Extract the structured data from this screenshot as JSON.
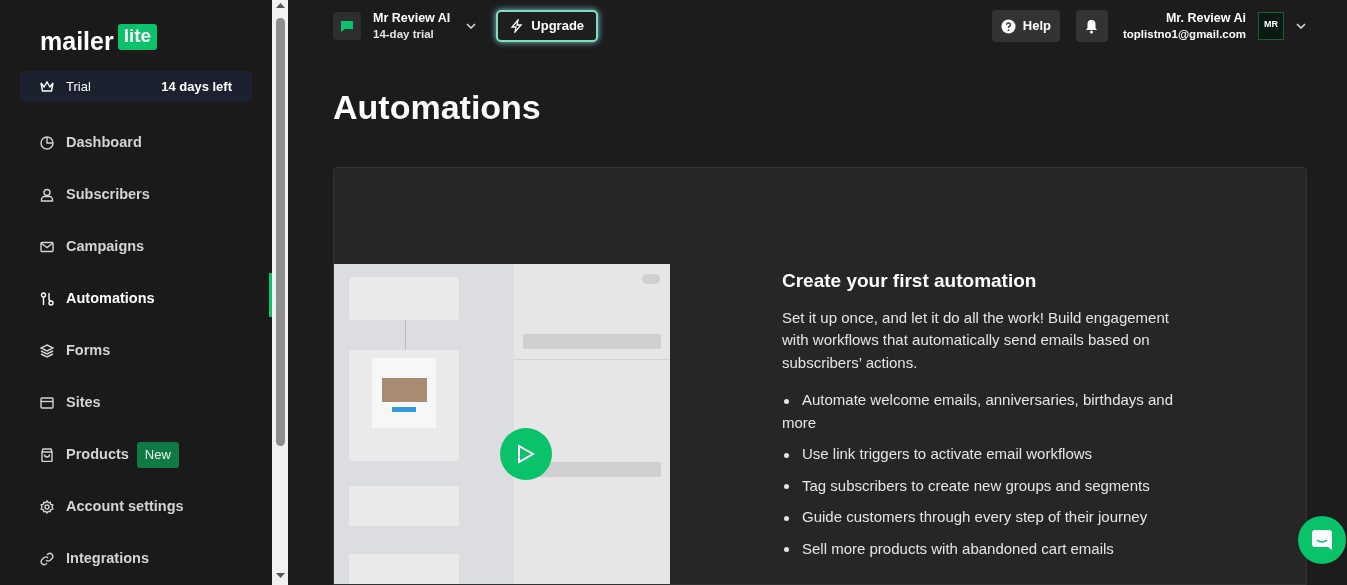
{
  "brand": {
    "name": "mailer",
    "badge": "lite"
  },
  "trial": {
    "label": "Trial",
    "days": "14 days left"
  },
  "nav": [
    {
      "label": "Dashboard",
      "selected": false
    },
    {
      "label": "Subscribers",
      "selected": false
    },
    {
      "label": "Campaigns",
      "selected": false
    },
    {
      "label": "Automations",
      "selected": true
    },
    {
      "label": "Forms",
      "selected": false
    },
    {
      "label": "Sites",
      "selected": false
    },
    {
      "label": "Products",
      "selected": false,
      "badge": "New"
    },
    {
      "label": "Account settings",
      "selected": false
    },
    {
      "label": "Integrations",
      "selected": false
    }
  ],
  "header": {
    "workspace": {
      "name": "Mr Review AI",
      "plan": "14-day trial"
    },
    "upgrade": "Upgrade",
    "help": "Help",
    "user": {
      "name": "Mr. Review Ai",
      "email": "toplistno1@gmail.com",
      "avatar": "MR"
    }
  },
  "page_title": "Automations",
  "promo": {
    "title": "Create your first automation",
    "body": "Set it up once, and let it do all the work! Build engagement with workflows that automatically send emails based on subscribers’ actions.",
    "bullets": [
      "Automate welcome emails, anniversaries, birthdays and more",
      "Use link triggers to activate email workflows",
      "Tag subscribers to create new groups and segments",
      "Guide customers through every step of their journey",
      "Sell more products with abandoned cart emails"
    ]
  }
}
